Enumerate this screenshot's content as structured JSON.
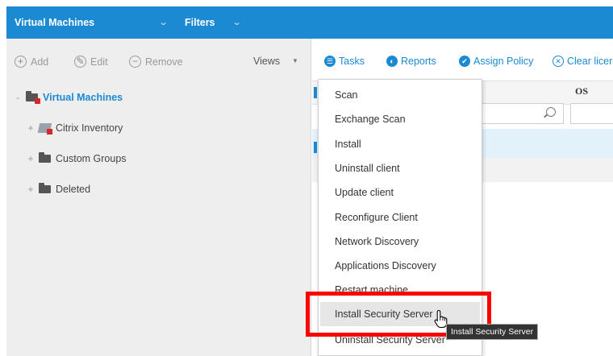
{
  "topbar": {
    "title": "Virtual Machines",
    "filters": "Filters"
  },
  "left_toolbar": {
    "add": "Add",
    "edit": "Edit",
    "remove": "Remove",
    "views": "Views"
  },
  "tree": {
    "root": "Virtual Machines",
    "items": [
      "Citrix Inventory",
      "Custom Groups",
      "Deleted"
    ]
  },
  "right_toolbar": {
    "tasks": "Tasks",
    "reports": "Reports",
    "assign_policy": "Assign Policy",
    "clear_license": "Clear licer"
  },
  "grid": {
    "os_header": "OS"
  },
  "menu": {
    "items": [
      "Scan",
      "Exchange Scan",
      "Install",
      "Uninstall client",
      "Update client",
      "Reconfigure Client",
      "Network Discovery",
      "Applications Discovery",
      "Restart machine",
      "Install Security Server",
      "Uninstall Security Server"
    ]
  },
  "tooltip": "Install Security Server",
  "colors": {
    "accent": "#1b8ad3",
    "highlight": "#ff0000"
  }
}
